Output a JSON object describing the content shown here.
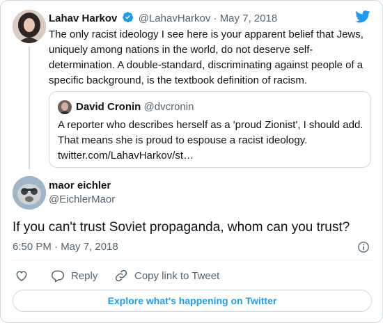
{
  "parent_tweet": {
    "name": "Lahav Harkov",
    "handle": "@LahavHarkov",
    "separator": "·",
    "date": "May 7, 2018",
    "text": "The only racist ideology I see here is your apparent belief that Jews, uniquely among nations in the world, do not deserve self-determination. A double-standard, discriminating against people of a specific background, is the textbook definition of racism.",
    "verified_icon": "verified-badge-icon",
    "brand_icon": "twitter-bird-icon"
  },
  "quoted_tweet": {
    "name": "David Cronin",
    "handle": "@dvcronin",
    "text": "A reporter who describes herself as a 'proud Zionist', I should add. That means she is proud to espouse a racist ideology. twitter.com/LahavHarkov/st…"
  },
  "main_tweet": {
    "name": "maor eichler",
    "handle": "@EichlerMaor",
    "text": "If you can't trust Soviet propaganda, whom can you trust?",
    "timestamp": "6:50 PM · May 7, 2018"
  },
  "actions": {
    "reply_label": "Reply",
    "copy_label": "Copy link to Tweet"
  },
  "footer": {
    "explore_label": "Explore what's happening on Twitter"
  },
  "colors": {
    "accent": "#1d9bf0",
    "text": "#0f1419",
    "muted": "#536471",
    "border": "#cfd9de"
  }
}
